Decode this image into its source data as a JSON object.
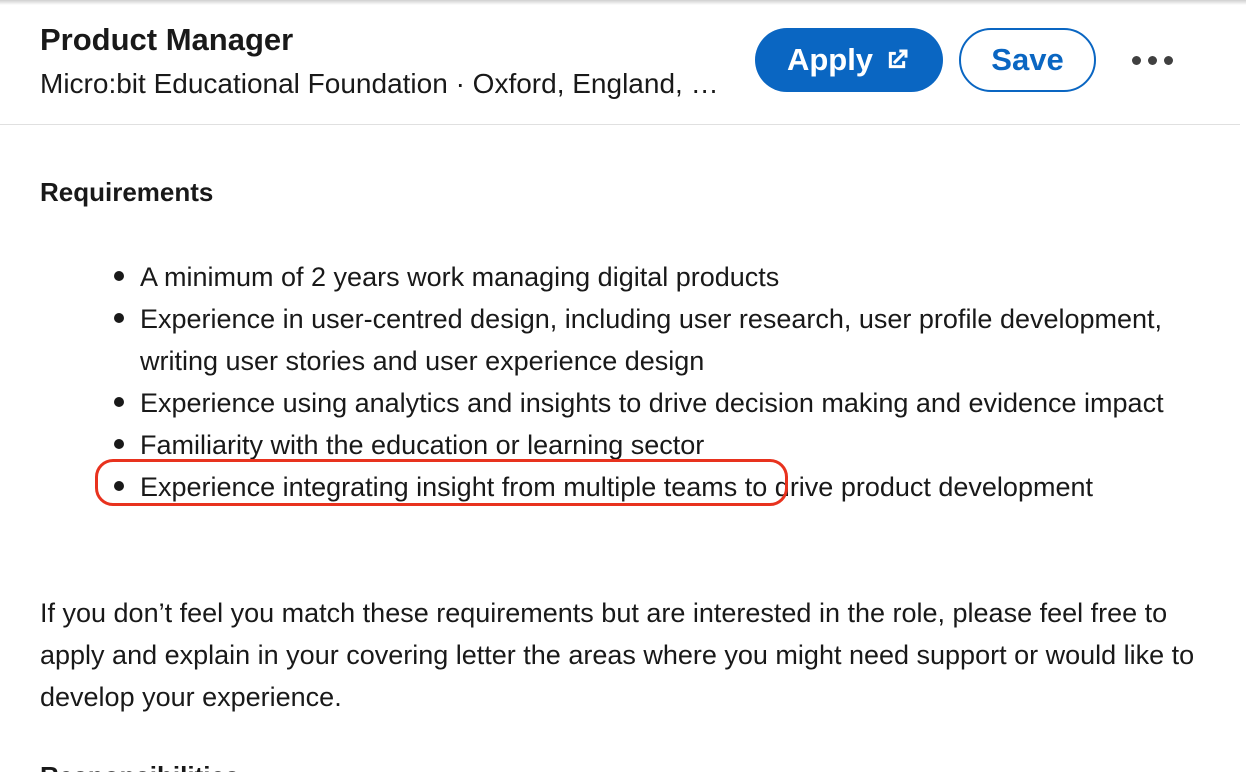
{
  "header": {
    "title": "Product Manager",
    "subtitle": "Micro:bit Educational Foundation · Oxford, England, United Kingdom",
    "apply_label": "Apply",
    "apply_icon": "external-link-icon",
    "save_label": "Save",
    "more_icon": "more-options-icon"
  },
  "requirements": {
    "heading": "Requirements",
    "items": [
      "A minimum of 2 years work managing digital products",
      "Experience in user-centred design, including user research, user profile development, writing user stories and user experience design",
      "Experience using analytics and insights to drive decision making and evidence impact",
      "Familiarity with the education or learning sector",
      "Experience integrating insight from multiple teams to drive product development"
    ],
    "highlighted_item_index": 3,
    "highlight_color": "#e8321e"
  },
  "closing_paragraph": "If you don’t feel you match these requirements but are interested in the role, please feel free to apply and explain in your covering letter the areas where you might need support or would like to develop your experience.",
  "next_section_heading": "Responsibilities",
  "colors": {
    "accent": "#0a66c2",
    "text": "#191919",
    "highlight": "#e8321e"
  }
}
